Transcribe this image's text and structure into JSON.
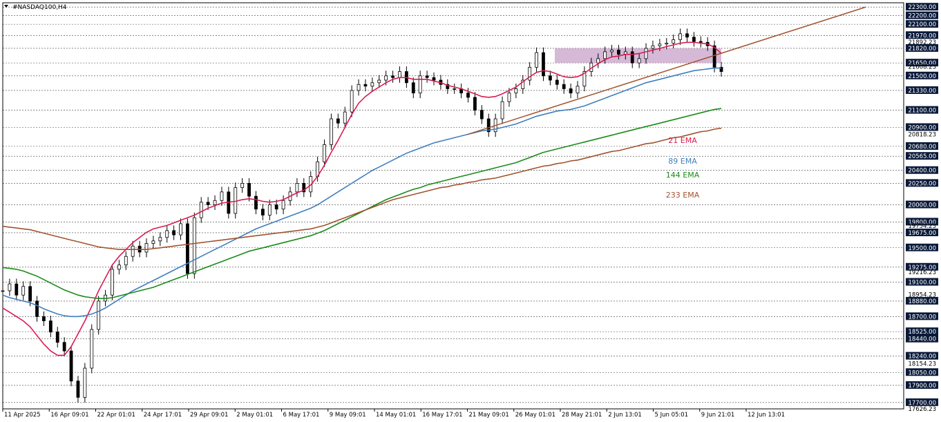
{
  "chart_data": {
    "type": "line",
    "title": "#NASDAQ100,H4",
    "x": [
      "11 Apr 2025",
      "16 Apr 09:01",
      "22 Apr 01:01",
      "24 Apr 17:01",
      "29 Apr 09:01",
      "2 May 01:01",
      "6 May 17:01",
      "9 May 09:01",
      "14 May 01:01",
      "16 May 17:01",
      "21 May 09:01",
      "26 May 01:01",
      "28 May 21:01",
      "2 Jun 13:01",
      "5 Jun 05:01",
      "9 Jun 21:01",
      "12 Jun 13:01"
    ],
    "ylim": [
      17626.23,
      22350
    ],
    "y_ticks": [
      22300,
      22200,
      22100,
      21970,
      21820,
      21650,
      21500,
      21330,
      21100,
      20900,
      20680,
      20565,
      20400,
      20250,
      20000,
      19800,
      19675,
      19500,
      19275,
      19100,
      18880,
      18700,
      18525,
      18440,
      18240,
      18050,
      17900,
      17700
    ],
    "y_marker_labels": [
      21892.23,
      21608.23,
      20818.23,
      19754.23,
      19216.23,
      18954.23,
      18154.23,
      17626.23
    ],
    "highlighted_labels": [
      22300,
      22200,
      22100,
      21970,
      21820,
      21650,
      21500,
      21330,
      21100,
      20900,
      20680,
      20565,
      20400,
      20250,
      20000,
      19800,
      19675,
      19500,
      19275,
      19100,
      18880,
      18700,
      18525,
      18440,
      18240,
      18050,
      17900,
      17700
    ],
    "price_close": [
      19000,
      19080,
      18950,
      19050,
      18880,
      18700,
      18650,
      18520,
      18400,
      18300,
      17950,
      17760,
      18100,
      18550,
      18880,
      18950,
      19250,
      19300,
      19400,
      19520,
      19450,
      19550,
      19580,
      19620,
      19700,
      19650,
      19780,
      19200,
      19850,
      20030,
      20000,
      20050,
      20150,
      19900,
      20200,
      20250,
      20100,
      19950,
      19880,
      20000,
      19950,
      20050,
      20150,
      20250,
      20150,
      20330,
      20500,
      20700,
      21000,
      20950,
      21080,
      21330,
      21400,
      21380,
      21420,
      21450,
      21500,
      21480,
      21550,
      21420,
      21300,
      21500,
      21480,
      21450,
      21400,
      21350,
      21350,
      21300,
      21250,
      21100,
      21000,
      20850,
      21000,
      21200,
      21300,
      21350,
      21450,
      21600,
      21770,
      21500,
      21450,
      21400,
      21350,
      21300,
      21380,
      21550,
      21650,
      21700,
      21780,
      21800,
      21750,
      21780,
      21650,
      21700,
      21820,
      21850,
      21870,
      21880,
      21920,
      21990,
      21950,
      21900,
      21890,
      21850,
      21600,
      21550
    ],
    "series": [
      {
        "name": "21 EMA",
        "color": "#d81b50",
        "values": [
          18800,
          18750,
          18700,
          18650,
          18580,
          18480,
          18380,
          18300,
          18250,
          18250,
          18350,
          18500,
          18650,
          18820,
          19000,
          19150,
          19300,
          19400,
          19480,
          19560,
          19620,
          19680,
          19720,
          19740,
          19760,
          19790,
          19820,
          19850,
          19880,
          19920,
          19960,
          19990,
          20020,
          20030,
          20040,
          20060,
          20070,
          20060,
          20040,
          20030,
          20040,
          20060,
          20100,
          20140,
          20170,
          20230,
          20330,
          20460,
          20610,
          20750,
          20900,
          21050,
          21180,
          21260,
          21320,
          21370,
          21420,
          21460,
          21480,
          21480,
          21460,
          21460,
          21460,
          21440,
          21420,
          21390,
          21370,
          21350,
          21320,
          21290,
          21260,
          21250,
          21260,
          21290,
          21330,
          21370,
          21430,
          21490,
          21540,
          21560,
          21550,
          21520,
          21490,
          21480,
          21490,
          21530,
          21590,
          21640,
          21690,
          21720,
          21730,
          21750,
          21750,
          21760,
          21780,
          21800,
          21820,
          21840,
          21860,
          21880,
          21890,
          21890,
          21880,
          21870,
          21830,
          21760
        ]
      },
      {
        "name": "89 EMA",
        "color": "#3f7ebf",
        "values": [
          18950,
          18920,
          18900,
          18880,
          18860,
          18830,
          18790,
          18760,
          18730,
          18710,
          18700,
          18700,
          18710,
          18730,
          18760,
          18800,
          18850,
          18900,
          18950,
          19000,
          19040,
          19080,
          19120,
          19160,
          19200,
          19240,
          19280,
          19320,
          19360,
          19400,
          19440,
          19480,
          19520,
          19560,
          19600,
          19640,
          19680,
          19720,
          19750,
          19780,
          19810,
          19840,
          19870,
          19900,
          19930,
          19960,
          20000,
          20050,
          20100,
          20150,
          20200,
          20250,
          20300,
          20350,
          20400,
          20440,
          20480,
          20520,
          20560,
          20600,
          20630,
          20660,
          20690,
          20720,
          20740,
          20760,
          20780,
          20800,
          20820,
          20840,
          20860,
          20870,
          20880,
          20900,
          20920,
          20940,
          20970,
          21000,
          21030,
          21050,
          21070,
          21090,
          21100,
          21110,
          21130,
          21150,
          21180,
          21210,
          21240,
          21270,
          21300,
          21330,
          21360,
          21390,
          21420,
          21440,
          21460,
          21480,
          21500,
          21520,
          21540,
          21560,
          21570,
          21580,
          21590,
          21590
        ]
      },
      {
        "name": "144 EMA",
        "color": "#1a8a1a",
        "values": [
          19270,
          19260,
          19250,
          19230,
          19200,
          19170,
          19130,
          19090,
          19050,
          19010,
          18980,
          18950,
          18930,
          18920,
          18910,
          18910,
          18920,
          18940,
          18960,
          18980,
          19000,
          19020,
          19040,
          19070,
          19100,
          19130,
          19160,
          19190,
          19220,
          19250,
          19280,
          19310,
          19340,
          19370,
          19400,
          19430,
          19460,
          19480,
          19500,
          19520,
          19540,
          19560,
          19580,
          19600,
          19620,
          19640,
          19670,
          19700,
          19740,
          19780,
          19820,
          19860,
          19900,
          19940,
          19980,
          20020,
          20060,
          20090,
          20120,
          20150,
          20180,
          20200,
          20230,
          20250,
          20270,
          20290,
          20310,
          20330,
          20350,
          20370,
          20390,
          20410,
          20430,
          20450,
          20470,
          20490,
          20520,
          20550,
          20580,
          20610,
          20630,
          20650,
          20670,
          20690,
          20710,
          20730,
          20750,
          20770,
          20790,
          20810,
          20830,
          20850,
          20870,
          20890,
          20910,
          20930,
          20950,
          20970,
          20990,
          21010,
          21030,
          21050,
          21070,
          21090,
          21110,
          21120
        ]
      },
      {
        "name": "233 EMA",
        "color": "#a0522d",
        "values": [
          19750,
          19740,
          19730,
          19720,
          19710,
          19690,
          19670,
          19650,
          19630,
          19610,
          19590,
          19570,
          19550,
          19530,
          19510,
          19500,
          19490,
          19480,
          19480,
          19480,
          19480,
          19480,
          19490,
          19500,
          19510,
          19520,
          19530,
          19540,
          19550,
          19560,
          19570,
          19580,
          19590,
          19600,
          19610,
          19620,
          19630,
          19640,
          19650,
          19660,
          19670,
          19680,
          19690,
          19700,
          19710,
          19720,
          19740,
          19760,
          19790,
          19820,
          19850,
          19880,
          19910,
          19940,
          19970,
          20000,
          20030,
          20060,
          20080,
          20100,
          20120,
          20140,
          20160,
          20180,
          20200,
          20210,
          20230,
          20240,
          20260,
          20270,
          20290,
          20300,
          20310,
          20330,
          20350,
          20370,
          20390,
          20410,
          20430,
          20450,
          20460,
          20480,
          20490,
          20510,
          20520,
          20540,
          20560,
          20580,
          20600,
          20620,
          20630,
          20650,
          20670,
          20690,
          20710,
          20720,
          20740,
          20760,
          20780,
          20790,
          20810,
          20830,
          20850,
          20860,
          20880,
          20890
        ]
      }
    ],
    "trendline_start": {
      "x": "21 May 09:01",
      "y": 20818.23
    },
    "trendline_end": {
      "x": "12 Jun 13:01",
      "y": 22300
    },
    "resistance_zone": {
      "x_start": "28 May 21:01",
      "x_end": "12 Jun 13:01",
      "y_low": 21650,
      "y_high": 21820,
      "color": "#c8a2c8"
    },
    "grid": true,
    "legend_placement": "right-center"
  }
}
